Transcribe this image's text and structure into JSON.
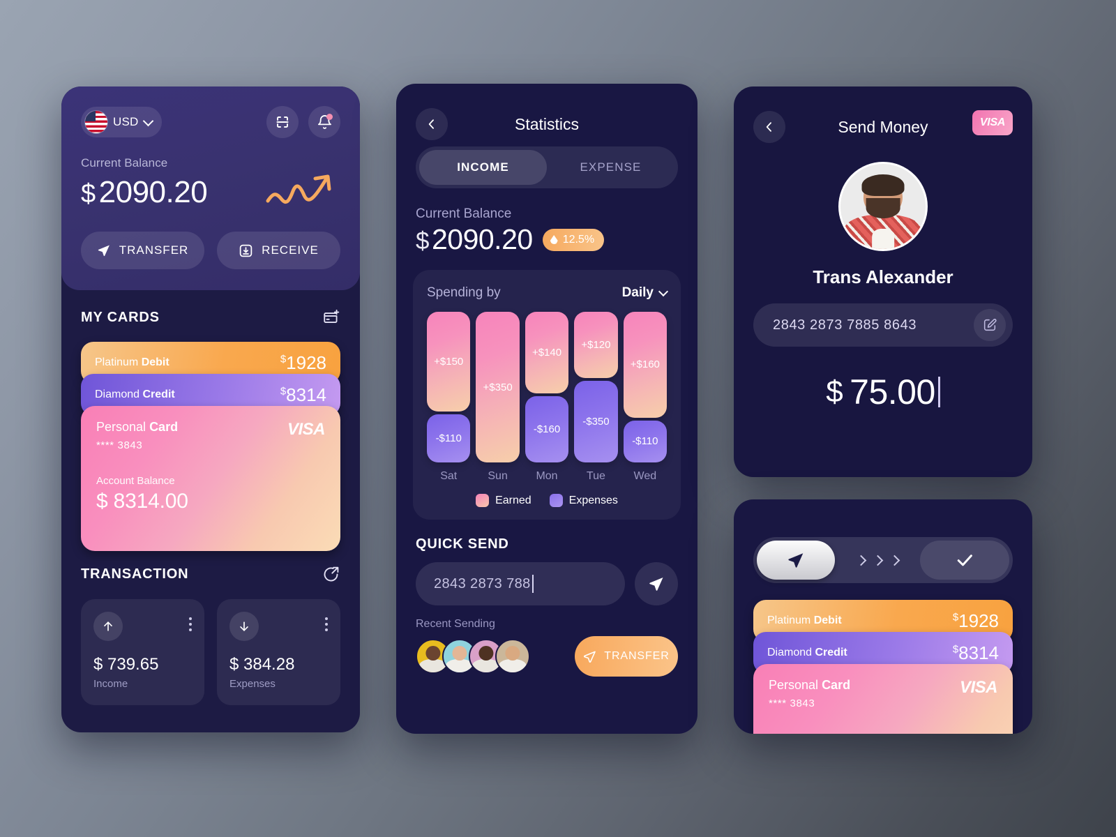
{
  "home": {
    "currency": {
      "label": "USD",
      "icon": "us-flag-icon",
      "chevron": "chevron-down-icon"
    },
    "scan_icon": "scan-icon",
    "bell_icon": "bell-icon",
    "balance_label": "Current Balance",
    "balance_currency": "$",
    "balance_value": "2090.20",
    "sparkline_icon": "trend-up-arrow-icon",
    "transfer_label": "TRANSFER",
    "receive_label": "RECEIVE",
    "cards_section_title": "MY CARDS",
    "add_card_icon": "add-card-icon",
    "cards": [
      {
        "name_light": "Platinum",
        "name_bold": "Debit",
        "currency": "$",
        "amount": "1928"
      },
      {
        "name_light": "Diamond",
        "name_bold": "Credit",
        "currency": "$",
        "amount": "8314"
      }
    ],
    "personal_card": {
      "name_light": "Personal",
      "name_bold": "Card",
      "brand": "VISA",
      "masked_number": "**** 3843",
      "balance_label": "Account Balance",
      "balance_currency": "$",
      "balance_value": "8314.00"
    },
    "transaction_section_title": "TRANSACTION",
    "share_icon": "share-arrow-icon",
    "transactions": [
      {
        "icon": "arrow-up-icon",
        "amount": "$ 739.65",
        "label": "Income"
      },
      {
        "icon": "arrow-down-icon",
        "amount": "$ 384.28",
        "label": "Expenses"
      }
    ]
  },
  "statistics": {
    "back_icon": "chevron-left-icon",
    "title": "Statistics",
    "tabs": [
      {
        "label": "INCOME",
        "active": true
      },
      {
        "label": "EXPENSE",
        "active": false
      }
    ],
    "balance_label": "Current Balance",
    "balance_currency": "$",
    "balance_value": "2090.20",
    "badge_value": "12.5%",
    "badge_icon": "drop-icon",
    "chart_title": "Spending by",
    "chart_period": "Daily",
    "period_chevron": "chevron-down-icon",
    "quick_send_title": "QUICK SEND",
    "quick_send_value": "2843 2873 788",
    "quick_send_icon": "send-icon",
    "recent_label": "Recent Sending",
    "transfer_label": "TRANSFER",
    "transfer_icon": "send-icon",
    "avatars": [
      {
        "bg": "#e8bc1f",
        "skin": "#6b4430",
        "hair": "#2b1a12"
      },
      {
        "bg": "#8fd3dd",
        "skin": "#e3b696",
        "hair": "#20242c"
      },
      {
        "bg": "#d9a0c8",
        "skin": "#4e3222",
        "hair": "#171717"
      },
      {
        "bg": "#cbb79a",
        "skin": "#d9a981",
        "hair": "#241812"
      }
    ]
  },
  "chart_data": {
    "type": "bar",
    "title": "Spending by",
    "subtitle": "Daily",
    "categories": [
      "Sat",
      "Sun",
      "Mon",
      "Tue",
      "Wed"
    ],
    "series": [
      {
        "name": "Earned",
        "values": [
          150,
          350,
          140,
          120,
          160
        ],
        "labels": [
          "+$150",
          "+$350",
          "+$140",
          "+$120",
          "+$160"
        ],
        "color": "#f583b9"
      },
      {
        "name": "Expenses",
        "values": [
          110,
          0,
          160,
          350,
          110
        ],
        "labels": [
          "-$110",
          "",
          "-$160",
          "-$350",
          "-$110"
        ],
        "color": "#8a70ea"
      }
    ],
    "legend": [
      "Earned",
      "Expenses"
    ],
    "legend_position": "bottom",
    "xlabel": "",
    "ylabel": "",
    "grid": false,
    "bar_heights_pct": {
      "earned": [
        66,
        100,
        54,
        44,
        70
      ],
      "expenses": [
        32,
        0,
        44,
        54,
        28
      ]
    }
  },
  "send_money": {
    "back_icon": "chevron-left-icon",
    "title": "Send Money",
    "brand_badge": "VISA",
    "avatar_icon": "user-avatar",
    "recipient_name": "Trans Alexander",
    "account_number": "2843 2873 7885 8643",
    "edit_icon": "edit-pencil-icon",
    "amount_currency": "$",
    "amount_value": "75.00"
  },
  "confirm": {
    "slider_icon": "send-icon",
    "chevrons_icon": "chevron-right-icon",
    "check_icon": "check-icon",
    "cards": [
      {
        "name_light": "Platinum",
        "name_bold": "Debit",
        "currency": "$",
        "amount": "1928"
      },
      {
        "name_light": "Diamond",
        "name_bold": "Credit",
        "currency": "$",
        "amount": "8314"
      }
    ],
    "personal_card": {
      "name_light": "Personal",
      "name_bold": "Card",
      "brand": "VISA",
      "masked_number": "**** 3843"
    }
  },
  "theme": {
    "accent_orange": "#f9a84e",
    "accent_pink": "#f97fb6",
    "accent_purple": "#8a70ea",
    "panel_dark": "#191743",
    "panel_head": "#3b3378"
  }
}
